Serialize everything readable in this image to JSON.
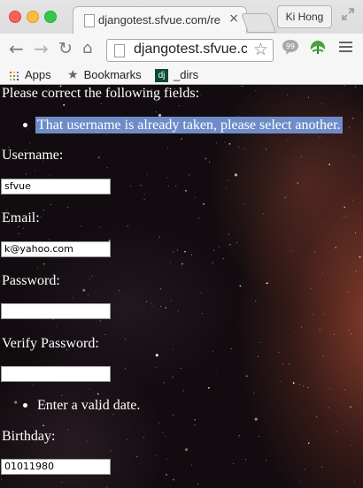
{
  "browser": {
    "tab_title": "djangotest.sfvue.com/re",
    "tab_close": "×",
    "profile_name": "Ki Hong",
    "url": "djangotest.sfvue.com",
    "bookmarks": [
      {
        "label": "Apps",
        "icon": "apps-grid-icon"
      },
      {
        "label": "Bookmarks",
        "icon": "star-icon"
      },
      {
        "label": "_dirs",
        "icon": "django-icon",
        "badge": "dj"
      }
    ]
  },
  "form": {
    "error_header": "Please correct the following fields:",
    "username_error": "That username is already taken, please select another.",
    "username_label": "Username:",
    "username_value": "sfvue",
    "email_label": "Email:",
    "email_value": "k@yahoo.com",
    "password_label": "Password:",
    "password_value": "",
    "verify_password_label": "Verify Password:",
    "verify_password_value": "",
    "date_error": "Enter a valid date.",
    "birthday_label": "Birthday:",
    "birthday_value": "01011980"
  },
  "colors": {
    "error_highlight": "#6e8cc8",
    "text": "#ffffff",
    "background": "#120c10"
  }
}
